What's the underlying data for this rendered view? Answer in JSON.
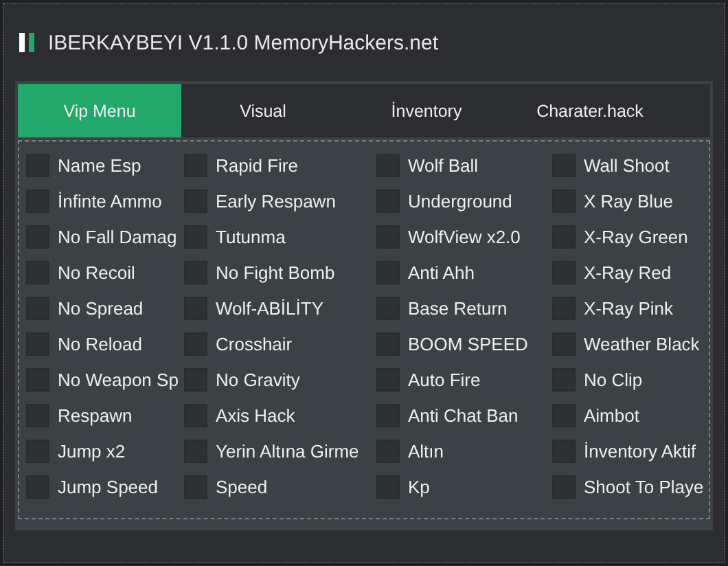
{
  "window": {
    "title": "IBERKAYBEYI V1.1.0 MemoryHackers.net"
  },
  "tabs": [
    {
      "label": "Vip Menu",
      "selected": true
    },
    {
      "label": "Visual",
      "selected": false
    },
    {
      "label": "İnventory",
      "selected": false
    },
    {
      "label": "Charater.hack",
      "selected": false
    }
  ],
  "columns": [
    {
      "items": [
        {
          "label": "Name Esp",
          "checked": false
        },
        {
          "label": "İnfinte Ammo",
          "checked": false
        },
        {
          "label": "No Fall Damag",
          "checked": false
        },
        {
          "label": "No Recoil",
          "checked": false
        },
        {
          "label": "No Spread",
          "checked": false
        },
        {
          "label": "No Reload",
          "checked": false
        },
        {
          "label": "No Weapon Sp",
          "checked": false
        },
        {
          "label": "Respawn",
          "checked": false
        },
        {
          "label": "Jump x2",
          "checked": false
        },
        {
          "label": "Jump Speed",
          "checked": false
        }
      ]
    },
    {
      "items": [
        {
          "label": "Rapid Fire",
          "checked": false
        },
        {
          "label": "Early Respawn",
          "checked": false
        },
        {
          "label": "Tutunma",
          "checked": false
        },
        {
          "label": "No Fight Bomb",
          "checked": false
        },
        {
          "label": "Wolf-ABİLİTY",
          "checked": false
        },
        {
          "label": "Crosshair",
          "checked": false
        },
        {
          "label": "No Gravity",
          "checked": false
        },
        {
          "label": "Axis Hack",
          "checked": false
        },
        {
          "label": "Yerin Altına Girme",
          "checked": false
        },
        {
          "label": "Speed",
          "checked": false
        }
      ]
    },
    {
      "items": [
        {
          "label": "Wolf Ball",
          "checked": false
        },
        {
          "label": "Underground",
          "checked": false
        },
        {
          "label": "WolfView x2.0",
          "checked": false
        },
        {
          "label": "Anti Ahh",
          "checked": false
        },
        {
          "label": "Base Return",
          "checked": false
        },
        {
          "label": "BOOM SPEED",
          "checked": false
        },
        {
          "label": "Auto Fire",
          "checked": false
        },
        {
          "label": "Anti Chat Ban",
          "checked": false
        },
        {
          "label": "Altın",
          "checked": false
        },
        {
          "label": "Kp",
          "checked": false
        }
      ]
    },
    {
      "items": [
        {
          "label": "Wall Shoot",
          "checked": false
        },
        {
          "label": "X Ray Blue",
          "checked": false
        },
        {
          "label": "X-Ray Green",
          "checked": false
        },
        {
          "label": "X-Ray Red",
          "checked": false
        },
        {
          "label": "X-Ray Pink",
          "checked": false
        },
        {
          "label": "Weather Black",
          "checked": false
        },
        {
          "label": "No Clip",
          "checked": false
        },
        {
          "label": "Aimbot",
          "checked": false
        },
        {
          "label": "İnventory Aktif",
          "checked": false
        },
        {
          "label": "Shoot To Playe",
          "checked": false
        }
      ]
    }
  ]
}
